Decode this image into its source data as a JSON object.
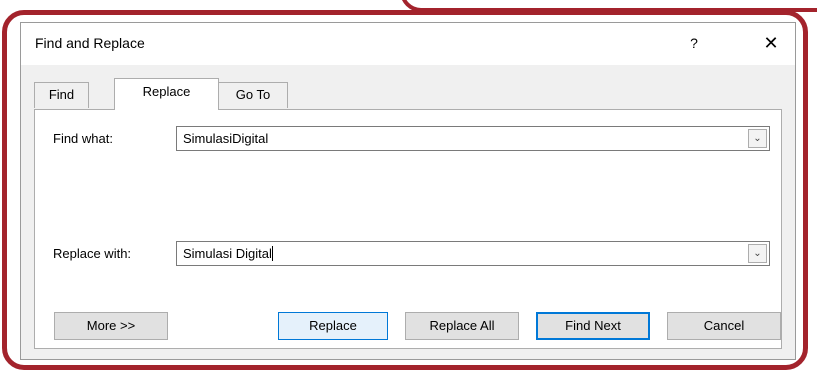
{
  "dialog": {
    "title": "Find and Replace",
    "help_label": "?",
    "close_label": "✕"
  },
  "tabs": [
    {
      "label": "Find",
      "active": false
    },
    {
      "label": "Replace",
      "active": true
    },
    {
      "label": "Go To",
      "active": false
    }
  ],
  "find": {
    "label": "Find what:",
    "value": "SimulasiDigital"
  },
  "replace": {
    "label": "Replace with:",
    "value": "Simulasi Digital"
  },
  "buttons": {
    "more": "More >>",
    "replace": "Replace",
    "replace_all": "Replace All",
    "find_next": "Find Next",
    "cancel": "Cancel"
  },
  "icons": {
    "dropdown": "chevron-down-icon"
  },
  "colors": {
    "annotation_frame": "#a3232c",
    "focus_blue": "#0078d7",
    "dialog_bg": "#f0f0f0"
  }
}
